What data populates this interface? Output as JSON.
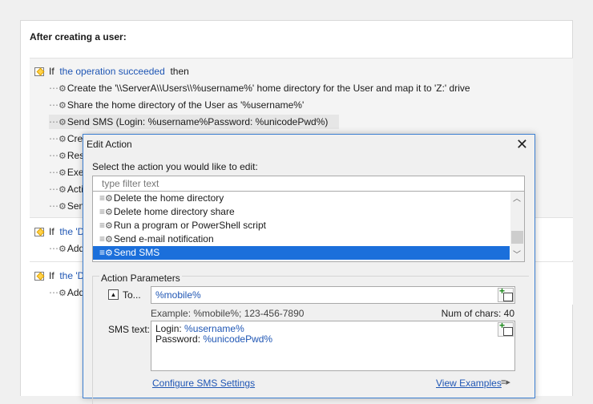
{
  "panel": {
    "title": "After creating a user:"
  },
  "rules": [
    {
      "if_word": "If",
      "condition": "the operation succeeded",
      "then_word": "then",
      "actions": [
        "Create the '\\\\ServerA\\\\Users\\\\%username%' home directory for the User and map it to 'Z:' drive",
        "Share the home directory of the User as '%username%'",
        "Send SMS (Login: %username%Password: %unicodePwd%)",
        "Creat",
        "Reset",
        "Execu",
        "Activa",
        "Send"
      ]
    },
    {
      "if_word": "If",
      "condition": "the 'D",
      "actions": [
        "Add t"
      ]
    },
    {
      "if_word": "If",
      "condition": "the 'D",
      "actions": [
        "Add t"
      ]
    }
  ],
  "dialog": {
    "title": "Edit Action",
    "select_label": "Select the action you would like to edit:",
    "filter_placeholder": "type filter text",
    "list_items": [
      "Delete the home directory",
      "Delete home directory share",
      "Run a program or PowerShell script",
      "Send e-mail notification",
      "Send SMS"
    ],
    "selected_index": 4,
    "group_title": "Action Parameters",
    "to_label": "To...",
    "to_value": "%mobile%",
    "example": "Example: %mobile%; 123-456-7890",
    "num_chars": "Num of chars: 40",
    "sms_label": "SMS text:",
    "sms_line1_prefix": "Login: ",
    "sms_line1_var": "%username%",
    "sms_line2_prefix": "Password: ",
    "sms_line2_var": "%unicodePwd%",
    "configure_link": "Configure SMS Settings",
    "examples_link": "View Examples"
  }
}
